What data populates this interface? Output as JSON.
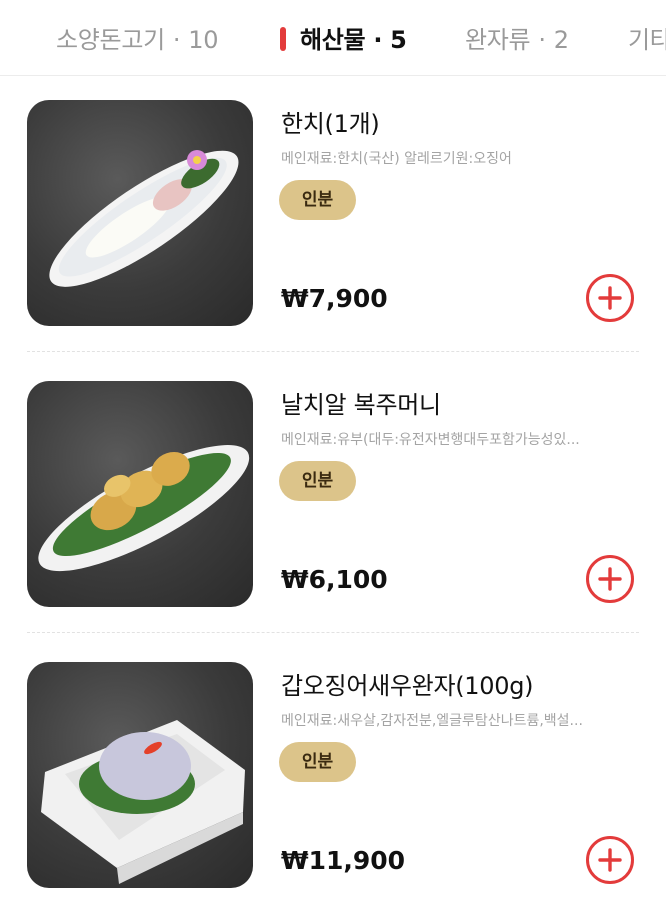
{
  "colors": {
    "accent": "#e33b3b",
    "badge_bg": "#dcc48a",
    "thumb_bg": "#3d3d3d"
  },
  "tabs": [
    {
      "label": "소양돈고기",
      "count": "10",
      "active": false
    },
    {
      "label": "해산물",
      "count": "5",
      "active": true
    },
    {
      "label": "완자류",
      "count": "2",
      "active": false
    },
    {
      "label": "기타",
      "count": "",
      "active": false
    }
  ],
  "tab_separator": "·",
  "items": [
    {
      "name": "한치(1개)",
      "desc": "메인재료:한치(국산) 알레르기원:오징어",
      "badge": "인분",
      "price": "₩7,900",
      "image_icon": "squid-plate-icon"
    },
    {
      "name": "날치알 복주머니",
      "desc": "메인재료:유부(대두:유전자변행대두포함가능성있...",
      "badge": "인분",
      "price": "₩6,100",
      "image_icon": "tofu-pouch-plate-icon"
    },
    {
      "name": "갑오징어새우완자(100g)",
      "desc": "메인재료:새우살,감자전분,엘글루탐산나트륨,백설...",
      "badge": "인분",
      "price": "₩11,900",
      "image_icon": "shrimp-ball-plate-icon"
    }
  ]
}
